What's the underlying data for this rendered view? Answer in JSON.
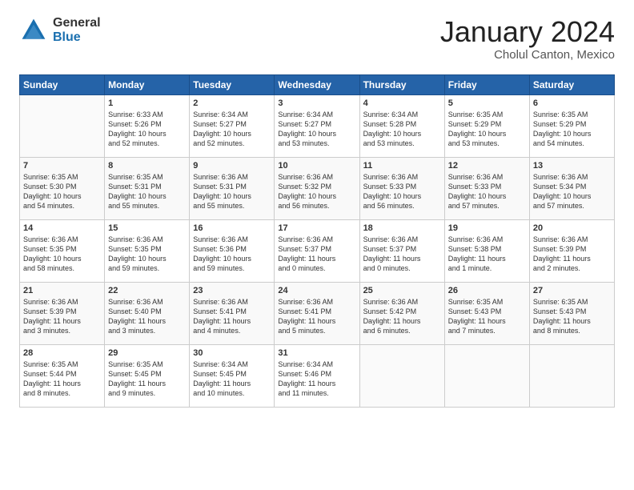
{
  "header": {
    "logo_general": "General",
    "logo_blue": "Blue",
    "month_title": "January 2024",
    "subtitle": "Cholul Canton, Mexico"
  },
  "weekdays": [
    "Sunday",
    "Monday",
    "Tuesday",
    "Wednesday",
    "Thursday",
    "Friday",
    "Saturday"
  ],
  "weeks": [
    [
      {
        "day": null,
        "content": null
      },
      {
        "day": "1",
        "content": "Sunrise: 6:33 AM\nSunset: 5:26 PM\nDaylight: 10 hours\nand 52 minutes."
      },
      {
        "day": "2",
        "content": "Sunrise: 6:34 AM\nSunset: 5:27 PM\nDaylight: 10 hours\nand 52 minutes."
      },
      {
        "day": "3",
        "content": "Sunrise: 6:34 AM\nSunset: 5:27 PM\nDaylight: 10 hours\nand 53 minutes."
      },
      {
        "day": "4",
        "content": "Sunrise: 6:34 AM\nSunset: 5:28 PM\nDaylight: 10 hours\nand 53 minutes."
      },
      {
        "day": "5",
        "content": "Sunrise: 6:35 AM\nSunset: 5:29 PM\nDaylight: 10 hours\nand 53 minutes."
      },
      {
        "day": "6",
        "content": "Sunrise: 6:35 AM\nSunset: 5:29 PM\nDaylight: 10 hours\nand 54 minutes."
      }
    ],
    [
      {
        "day": "7",
        "content": "Sunrise: 6:35 AM\nSunset: 5:30 PM\nDaylight: 10 hours\nand 54 minutes."
      },
      {
        "day": "8",
        "content": "Sunrise: 6:35 AM\nSunset: 5:31 PM\nDaylight: 10 hours\nand 55 minutes."
      },
      {
        "day": "9",
        "content": "Sunrise: 6:36 AM\nSunset: 5:31 PM\nDaylight: 10 hours\nand 55 minutes."
      },
      {
        "day": "10",
        "content": "Sunrise: 6:36 AM\nSunset: 5:32 PM\nDaylight: 10 hours\nand 56 minutes."
      },
      {
        "day": "11",
        "content": "Sunrise: 6:36 AM\nSunset: 5:33 PM\nDaylight: 10 hours\nand 56 minutes."
      },
      {
        "day": "12",
        "content": "Sunrise: 6:36 AM\nSunset: 5:33 PM\nDaylight: 10 hours\nand 57 minutes."
      },
      {
        "day": "13",
        "content": "Sunrise: 6:36 AM\nSunset: 5:34 PM\nDaylight: 10 hours\nand 57 minutes."
      }
    ],
    [
      {
        "day": "14",
        "content": "Sunrise: 6:36 AM\nSunset: 5:35 PM\nDaylight: 10 hours\nand 58 minutes."
      },
      {
        "day": "15",
        "content": "Sunrise: 6:36 AM\nSunset: 5:35 PM\nDaylight: 10 hours\nand 59 minutes."
      },
      {
        "day": "16",
        "content": "Sunrise: 6:36 AM\nSunset: 5:36 PM\nDaylight: 10 hours\nand 59 minutes."
      },
      {
        "day": "17",
        "content": "Sunrise: 6:36 AM\nSunset: 5:37 PM\nDaylight: 11 hours\nand 0 minutes."
      },
      {
        "day": "18",
        "content": "Sunrise: 6:36 AM\nSunset: 5:37 PM\nDaylight: 11 hours\nand 0 minutes."
      },
      {
        "day": "19",
        "content": "Sunrise: 6:36 AM\nSunset: 5:38 PM\nDaylight: 11 hours\nand 1 minute."
      },
      {
        "day": "20",
        "content": "Sunrise: 6:36 AM\nSunset: 5:39 PM\nDaylight: 11 hours\nand 2 minutes."
      }
    ],
    [
      {
        "day": "21",
        "content": "Sunrise: 6:36 AM\nSunset: 5:39 PM\nDaylight: 11 hours\nand 3 minutes."
      },
      {
        "day": "22",
        "content": "Sunrise: 6:36 AM\nSunset: 5:40 PM\nDaylight: 11 hours\nand 3 minutes."
      },
      {
        "day": "23",
        "content": "Sunrise: 6:36 AM\nSunset: 5:41 PM\nDaylight: 11 hours\nand 4 minutes."
      },
      {
        "day": "24",
        "content": "Sunrise: 6:36 AM\nSunset: 5:41 PM\nDaylight: 11 hours\nand 5 minutes."
      },
      {
        "day": "25",
        "content": "Sunrise: 6:36 AM\nSunset: 5:42 PM\nDaylight: 11 hours\nand 6 minutes."
      },
      {
        "day": "26",
        "content": "Sunrise: 6:35 AM\nSunset: 5:43 PM\nDaylight: 11 hours\nand 7 minutes."
      },
      {
        "day": "27",
        "content": "Sunrise: 6:35 AM\nSunset: 5:43 PM\nDaylight: 11 hours\nand 8 minutes."
      }
    ],
    [
      {
        "day": "28",
        "content": "Sunrise: 6:35 AM\nSunset: 5:44 PM\nDaylight: 11 hours\nand 8 minutes."
      },
      {
        "day": "29",
        "content": "Sunrise: 6:35 AM\nSunset: 5:45 PM\nDaylight: 11 hours\nand 9 minutes."
      },
      {
        "day": "30",
        "content": "Sunrise: 6:34 AM\nSunset: 5:45 PM\nDaylight: 11 hours\nand 10 minutes."
      },
      {
        "day": "31",
        "content": "Sunrise: 6:34 AM\nSunset: 5:46 PM\nDaylight: 11 hours\nand 11 minutes."
      },
      {
        "day": null,
        "content": null
      },
      {
        "day": null,
        "content": null
      },
      {
        "day": null,
        "content": null
      }
    ]
  ]
}
